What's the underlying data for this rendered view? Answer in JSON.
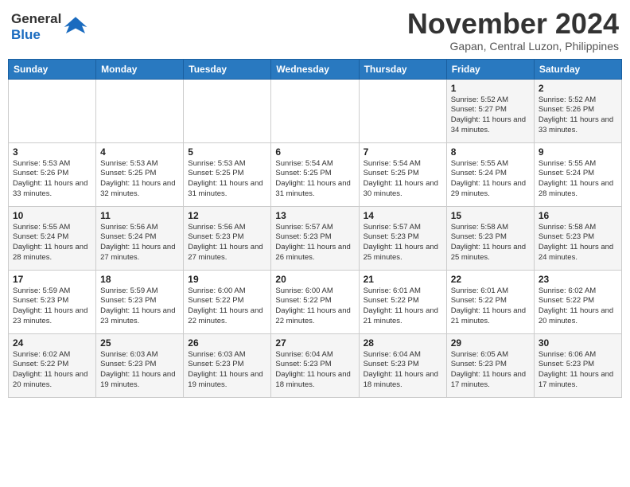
{
  "logo": {
    "general": "General",
    "blue": "Blue"
  },
  "title": "November 2024",
  "location": "Gapan, Central Luzon, Philippines",
  "days_of_week": [
    "Sunday",
    "Monday",
    "Tuesday",
    "Wednesday",
    "Thursday",
    "Friday",
    "Saturday"
  ],
  "weeks": [
    [
      {
        "day": "",
        "info": ""
      },
      {
        "day": "",
        "info": ""
      },
      {
        "day": "",
        "info": ""
      },
      {
        "day": "",
        "info": ""
      },
      {
        "day": "",
        "info": ""
      },
      {
        "day": "1",
        "info": "Sunrise: 5:52 AM\nSunset: 5:27 PM\nDaylight: 11 hours and 34 minutes."
      },
      {
        "day": "2",
        "info": "Sunrise: 5:52 AM\nSunset: 5:26 PM\nDaylight: 11 hours and 33 minutes."
      }
    ],
    [
      {
        "day": "3",
        "info": "Sunrise: 5:53 AM\nSunset: 5:26 PM\nDaylight: 11 hours and 33 minutes."
      },
      {
        "day": "4",
        "info": "Sunrise: 5:53 AM\nSunset: 5:25 PM\nDaylight: 11 hours and 32 minutes."
      },
      {
        "day": "5",
        "info": "Sunrise: 5:53 AM\nSunset: 5:25 PM\nDaylight: 11 hours and 31 minutes."
      },
      {
        "day": "6",
        "info": "Sunrise: 5:54 AM\nSunset: 5:25 PM\nDaylight: 11 hours and 31 minutes."
      },
      {
        "day": "7",
        "info": "Sunrise: 5:54 AM\nSunset: 5:25 PM\nDaylight: 11 hours and 30 minutes."
      },
      {
        "day": "8",
        "info": "Sunrise: 5:55 AM\nSunset: 5:24 PM\nDaylight: 11 hours and 29 minutes."
      },
      {
        "day": "9",
        "info": "Sunrise: 5:55 AM\nSunset: 5:24 PM\nDaylight: 11 hours and 28 minutes."
      }
    ],
    [
      {
        "day": "10",
        "info": "Sunrise: 5:55 AM\nSunset: 5:24 PM\nDaylight: 11 hours and 28 minutes."
      },
      {
        "day": "11",
        "info": "Sunrise: 5:56 AM\nSunset: 5:24 PM\nDaylight: 11 hours and 27 minutes."
      },
      {
        "day": "12",
        "info": "Sunrise: 5:56 AM\nSunset: 5:23 PM\nDaylight: 11 hours and 27 minutes."
      },
      {
        "day": "13",
        "info": "Sunrise: 5:57 AM\nSunset: 5:23 PM\nDaylight: 11 hours and 26 minutes."
      },
      {
        "day": "14",
        "info": "Sunrise: 5:57 AM\nSunset: 5:23 PM\nDaylight: 11 hours and 25 minutes."
      },
      {
        "day": "15",
        "info": "Sunrise: 5:58 AM\nSunset: 5:23 PM\nDaylight: 11 hours and 25 minutes."
      },
      {
        "day": "16",
        "info": "Sunrise: 5:58 AM\nSunset: 5:23 PM\nDaylight: 11 hours and 24 minutes."
      }
    ],
    [
      {
        "day": "17",
        "info": "Sunrise: 5:59 AM\nSunset: 5:23 PM\nDaylight: 11 hours and 23 minutes."
      },
      {
        "day": "18",
        "info": "Sunrise: 5:59 AM\nSunset: 5:23 PM\nDaylight: 11 hours and 23 minutes."
      },
      {
        "day": "19",
        "info": "Sunrise: 6:00 AM\nSunset: 5:22 PM\nDaylight: 11 hours and 22 minutes."
      },
      {
        "day": "20",
        "info": "Sunrise: 6:00 AM\nSunset: 5:22 PM\nDaylight: 11 hours and 22 minutes."
      },
      {
        "day": "21",
        "info": "Sunrise: 6:01 AM\nSunset: 5:22 PM\nDaylight: 11 hours and 21 minutes."
      },
      {
        "day": "22",
        "info": "Sunrise: 6:01 AM\nSunset: 5:22 PM\nDaylight: 11 hours and 21 minutes."
      },
      {
        "day": "23",
        "info": "Sunrise: 6:02 AM\nSunset: 5:22 PM\nDaylight: 11 hours and 20 minutes."
      }
    ],
    [
      {
        "day": "24",
        "info": "Sunrise: 6:02 AM\nSunset: 5:22 PM\nDaylight: 11 hours and 20 minutes."
      },
      {
        "day": "25",
        "info": "Sunrise: 6:03 AM\nSunset: 5:23 PM\nDaylight: 11 hours and 19 minutes."
      },
      {
        "day": "26",
        "info": "Sunrise: 6:03 AM\nSunset: 5:23 PM\nDaylight: 11 hours and 19 minutes."
      },
      {
        "day": "27",
        "info": "Sunrise: 6:04 AM\nSunset: 5:23 PM\nDaylight: 11 hours and 18 minutes."
      },
      {
        "day": "28",
        "info": "Sunrise: 6:04 AM\nSunset: 5:23 PM\nDaylight: 11 hours and 18 minutes."
      },
      {
        "day": "29",
        "info": "Sunrise: 6:05 AM\nSunset: 5:23 PM\nDaylight: 11 hours and 17 minutes."
      },
      {
        "day": "30",
        "info": "Sunrise: 6:06 AM\nSunset: 5:23 PM\nDaylight: 11 hours and 17 minutes."
      }
    ]
  ]
}
